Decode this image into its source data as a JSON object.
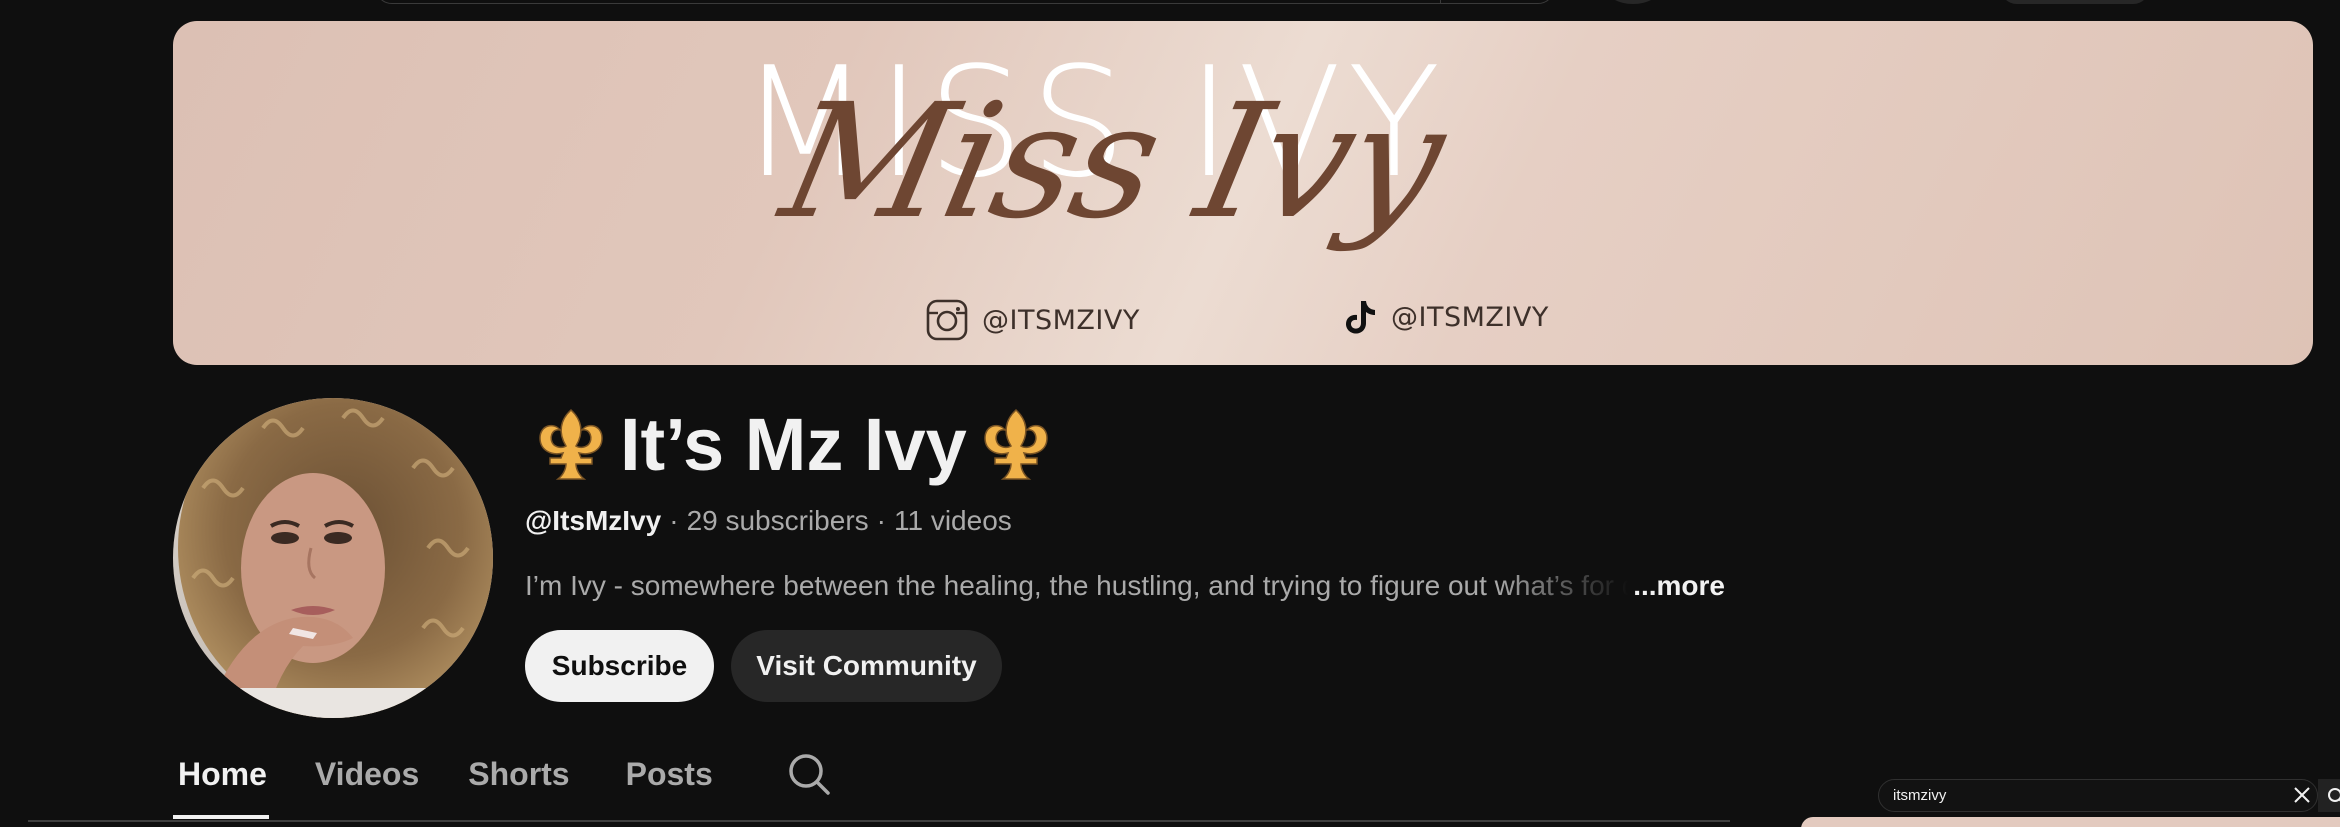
{
  "banner": {
    "title": "MISS IVY",
    "script_title": "Miss Ivy",
    "instagram_handle": "@ITSMZIVY",
    "tiktok_handle": "@ITSMZIVY"
  },
  "channel": {
    "name": "It’s Mz Ivy",
    "handle": "@ItsMzIvy",
    "separator": "·",
    "subscribers": "29 subscribers",
    "videos": "11 videos",
    "description": "I’m Ivy - somewhere between the healing, the hustling, and trying to figure out what’s for di",
    "more_label": "...more"
  },
  "buttons": {
    "subscribe": "Subscribe",
    "visit_community": "Visit Community"
  },
  "tabs": [
    {
      "label": "Home",
      "active": true
    },
    {
      "label": "Videos",
      "active": false
    },
    {
      "label": "Shorts",
      "active": false
    },
    {
      "label": "Posts",
      "active": false
    }
  ],
  "mini_search": {
    "value": "itsmzivy"
  },
  "icons": {
    "instagram": "instagram-icon",
    "tiktok": "tiktok-icon",
    "fleur_de_lis": "fleur-de-lis-icon",
    "search": "search-icon",
    "close": "close-icon"
  },
  "colors": {
    "background": "#0f0f0f",
    "text_primary": "#f1f1f1",
    "text_secondary": "#aaaaaa",
    "banner_pink": "#e1c7bb",
    "script_brown": "#6e4632",
    "fleur_gold": "#f0b24a"
  }
}
